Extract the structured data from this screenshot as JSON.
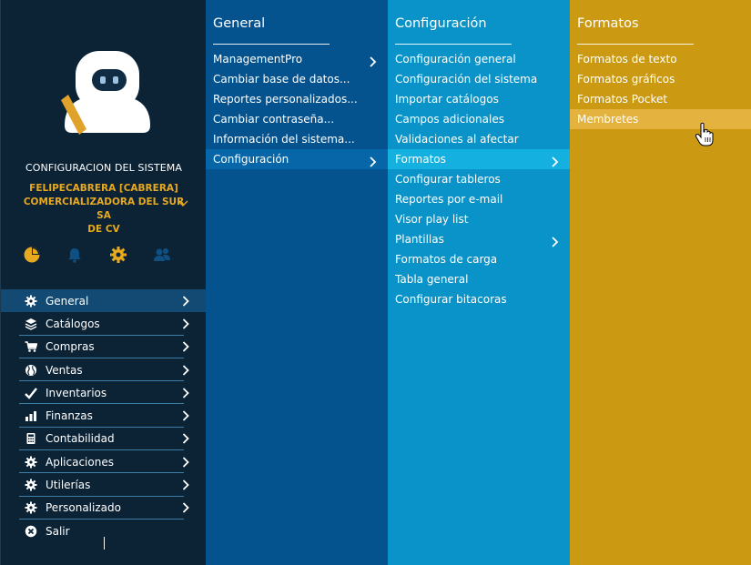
{
  "sidebar": {
    "app_title": "CONFIGURACION DEL SISTEMA",
    "user_line1": "FELIPECABRERA [CABRERA]",
    "user_line2": "COMERCIALIZADORA DEL SUR SA",
    "user_line3": "DE CV",
    "quick_icons": [
      "pie-chart-icon",
      "bell-icon",
      "gear-icon",
      "users-icon"
    ],
    "menu": [
      {
        "label": "General",
        "icon": "gear-icon",
        "active": true
      },
      {
        "label": "Catálogos",
        "icon": "layers-icon"
      },
      {
        "label": "Compras",
        "icon": "cart-icon"
      },
      {
        "label": "Ventas",
        "icon": "globe-icon"
      },
      {
        "label": "Inventarios",
        "icon": "check-icon"
      },
      {
        "label": "Finanzas",
        "icon": "bar-chart-icon"
      },
      {
        "label": "Contabilidad",
        "icon": "calculator-icon"
      },
      {
        "label": "Aplicaciones",
        "icon": "gear-icon"
      },
      {
        "label": "Utilerías",
        "icon": "gear-icon"
      },
      {
        "label": "Personalizado",
        "icon": "gear-icon"
      },
      {
        "label": "Salir",
        "icon": "close-circle-icon"
      }
    ]
  },
  "col1": {
    "title": "General",
    "items": [
      {
        "label": "ManagementPro",
        "submenu": true
      },
      {
        "label": "Cambiar base de datos..."
      },
      {
        "label": "Reportes personalizados..."
      },
      {
        "label": "Cambiar contraseña..."
      },
      {
        "label": "Información del sistema..."
      },
      {
        "label": "Configuración",
        "submenu": true,
        "active": true
      }
    ]
  },
  "col2": {
    "title": "Configuración",
    "items": [
      {
        "label": "Configuración general"
      },
      {
        "label": "Configuración del sistema"
      },
      {
        "label": "Importar catálogos"
      },
      {
        "label": "Campos adicionales"
      },
      {
        "label": "Validaciones al afectar"
      },
      {
        "label": "Formatos",
        "submenu": true,
        "active": true
      },
      {
        "label": "Configurar tableros"
      },
      {
        "label": "Reportes por e-mail"
      },
      {
        "label": "Visor play list"
      },
      {
        "label": "Plantillas",
        "submenu": true
      },
      {
        "label": "Formatos de carga"
      },
      {
        "label": "Tabla general"
      },
      {
        "label": "Configurar bitacoras"
      }
    ]
  },
  "col3": {
    "title": "Formatos",
    "items": [
      {
        "label": "Formatos de texto"
      },
      {
        "label": "Formatos gráficos"
      },
      {
        "label": "Formatos Pocket"
      },
      {
        "label": "Membretes",
        "active": true
      }
    ]
  },
  "colors": {
    "sidebar_bg": "#0c2336",
    "col1_bg": "#04538f",
    "col2_bg": "#0a93c8",
    "col3_bg": "#cc9a12",
    "accent_gold": "#e6a91f"
  }
}
